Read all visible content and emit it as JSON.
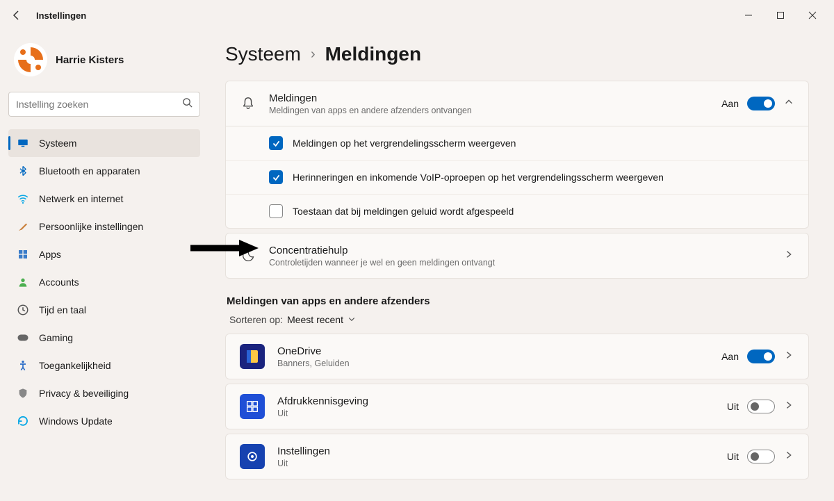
{
  "titlebar": {
    "app": "Instellingen"
  },
  "profile": {
    "name": "Harrie Kisters"
  },
  "search": {
    "placeholder": "Instelling zoeken"
  },
  "nav": [
    {
      "label": "Systeem",
      "icon": "monitor",
      "active": true
    },
    {
      "label": "Bluetooth en apparaten",
      "icon": "bluetooth"
    },
    {
      "label": "Netwerk en internet",
      "icon": "wifi"
    },
    {
      "label": "Persoonlijke instellingen",
      "icon": "brush"
    },
    {
      "label": "Apps",
      "icon": "apps"
    },
    {
      "label": "Accounts",
      "icon": "person"
    },
    {
      "label": "Tijd en taal",
      "icon": "clock"
    },
    {
      "label": "Gaming",
      "icon": "game"
    },
    {
      "label": "Toegankelijkheid",
      "icon": "access"
    },
    {
      "label": "Privacy & beveiliging",
      "icon": "shield"
    },
    {
      "label": "Windows Update",
      "icon": "update"
    }
  ],
  "breadcrumb": {
    "parent": "Systeem",
    "current": "Meldingen"
  },
  "notifications_card": {
    "title": "Meldingen",
    "sub": "Meldingen van apps en andere afzenders ontvangen",
    "state": "Aan",
    "options": [
      {
        "label": "Meldingen op het vergrendelingsscherm weergeven",
        "checked": true
      },
      {
        "label": "Herinneringen en inkomende VoIP-oproepen op het vergrendelingsscherm weergeven",
        "checked": true
      },
      {
        "label": "Toestaan dat bij meldingen geluid wordt afgespeeld",
        "checked": false
      }
    ]
  },
  "focus_card": {
    "title": "Concentratiehulp",
    "sub": "Controletijden wanneer je wel en geen meldingen ontvangt"
  },
  "apps_section": {
    "heading": "Meldingen van apps en andere afzenders",
    "sort_label": "Sorteren op:",
    "sort_value": "Meest recent",
    "apps": [
      {
        "name": "OneDrive",
        "sub": "Banners, Geluiden",
        "state": "Aan",
        "on": true,
        "icon": "onedrive"
      },
      {
        "name": "Afdrukkennisgeving",
        "sub": "Uit",
        "state": "Uit",
        "on": false,
        "icon": "print"
      },
      {
        "name": "Instellingen",
        "sub": "Uit",
        "state": "Uit",
        "on": false,
        "icon": "settings"
      }
    ]
  }
}
